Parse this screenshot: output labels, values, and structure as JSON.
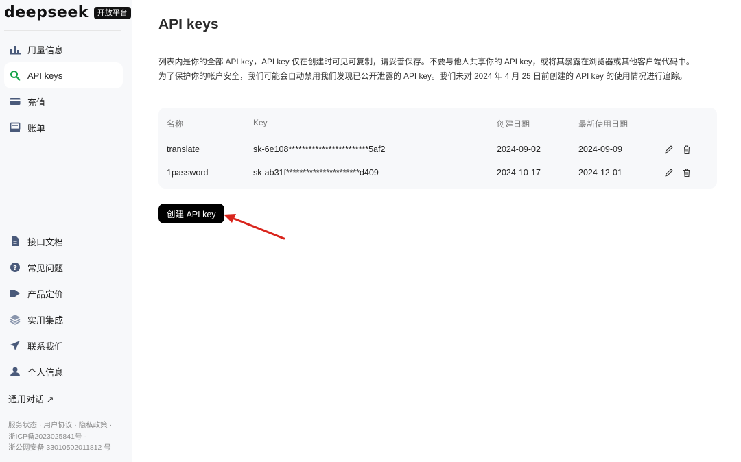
{
  "brand": {
    "logo": "deepseek",
    "badge": "开放平台"
  },
  "sidebar": {
    "top_items": [
      {
        "label": "用量信息",
        "icon": "bar-chart-icon",
        "active": false
      },
      {
        "label": "API keys",
        "icon": "search-icon",
        "active": true
      },
      {
        "label": "充值",
        "icon": "wallet-icon",
        "active": false
      },
      {
        "label": "账单",
        "icon": "receipt-icon",
        "active": false
      }
    ],
    "bottom_items": [
      {
        "label": "接口文档",
        "icon": "document-icon"
      },
      {
        "label": "常见问题",
        "icon": "help-icon"
      },
      {
        "label": "产品定价",
        "icon": "tag-icon"
      },
      {
        "label": "实用集成",
        "icon": "layers-icon"
      },
      {
        "label": "联系我们",
        "icon": "send-icon"
      },
      {
        "label": "个人信息",
        "icon": "user-icon"
      }
    ],
    "chat_link": "通用对话 ↗",
    "footer": {
      "status": "服务状态",
      "terms": "用户协议",
      "privacy": "隐私政策",
      "icp": "浙ICP备2023025841号 ·",
      "security": "浙公网安备 33010502011812 号"
    }
  },
  "main": {
    "title": "API keys",
    "desc_line1": "列表内是你的全部 API key，API key 仅在创建时可见可复制，请妥善保存。不要与他人共享你的 API key，或将其暴露在浏览器或其他客户端代码中。",
    "desc_line2": "为了保护你的帐户安全，我们可能会自动禁用我们发现已公开泄露的 API key。我们未对 2024 年 4 月 25 日前创建的 API key 的使用情况进行追踪。",
    "table": {
      "columns": [
        "名称",
        "Key",
        "创建日期",
        "最新使用日期"
      ],
      "rows": [
        {
          "name": "translate",
          "key": "sk-6e108************************5af2",
          "created": "2024-09-02",
          "last_used": "2024-09-09"
        },
        {
          "name": "1password",
          "key": "sk-ab31f**********************d409",
          "created": "2024-10-17",
          "last_used": "2024-12-01"
        }
      ]
    },
    "create_button": "创建 API key"
  },
  "colors": {
    "accent_arrow": "#d9251d",
    "button_bg": "#000000",
    "sidebar_bg": "#f7f8fa",
    "card_bg": "#f7f8fa"
  }
}
